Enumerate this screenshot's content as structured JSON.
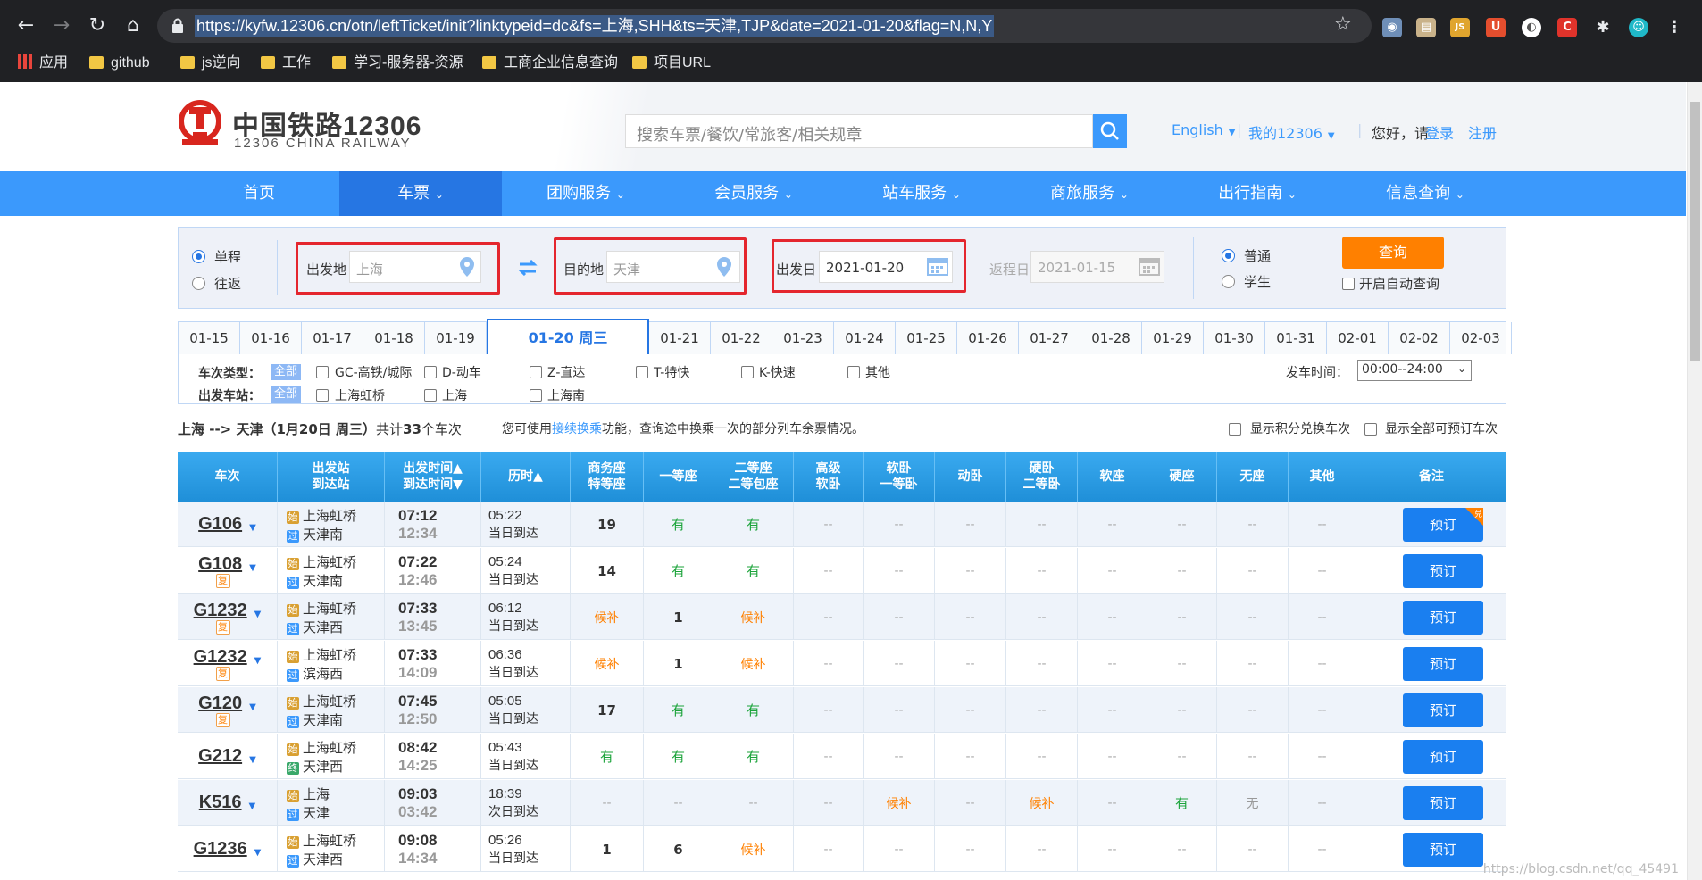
{
  "browser": {
    "url": "https://kyfw.12306.cn/otn/leftTicket/init?linktypeid=dc&fs=上海,SHH&ts=天津,TJP&date=2021-01-20&flag=N,N,Y",
    "bookmarks": [
      "应用",
      "github",
      "js逆向",
      "工作",
      "学习-服务器-资源",
      "工商企业信息查询",
      "项目URL"
    ],
    "ext_labels": {
      "u": "U",
      "c": "C",
      "js": "JS"
    }
  },
  "header": {
    "logo_cn": "中国铁路12306",
    "logo_en": "12306 CHINA RAILWAY",
    "search_placeholder": "搜索车票/餐饮/常旅客/相关规章",
    "english": "English",
    "my12306": "我的12306",
    "hello": "您好，请",
    "login": "登录",
    "register": "注册"
  },
  "nav": [
    "首页",
    "车票",
    "团购服务",
    "会员服务",
    "站车服务",
    "商旅服务",
    "出行指南",
    "信息查询"
  ],
  "query": {
    "oneway": "单程",
    "roundtrip": "往返",
    "from_label": "出发地",
    "from_value": "上海",
    "to_label": "目的地",
    "to_value": "天津",
    "date_label": "出发日",
    "date_value": "2021-01-20",
    "return_label": "返程日",
    "return_value": "2021-01-15",
    "normal": "普通",
    "student": "学生",
    "search_btn": "查询",
    "auto_query": "开启自动查询"
  },
  "dates": [
    "01-15",
    "01-16",
    "01-17",
    "01-18",
    "01-19",
    "01-20 周三",
    "01-21",
    "01-22",
    "01-23",
    "01-24",
    "01-25",
    "01-26",
    "01-27",
    "01-28",
    "01-29",
    "01-30",
    "01-31",
    "02-01",
    "02-02",
    "02-03"
  ],
  "filters": {
    "type_label": "车次类型：",
    "station_label": "出发车站：",
    "all": "全部",
    "types": [
      "GC-高铁/城际",
      "D-动车",
      "Z-直达",
      "T-特快",
      "K-快速",
      "其他"
    ],
    "stations": [
      "上海虹桥",
      "上海",
      "上海南"
    ],
    "time_label": "发车时间：",
    "time_value": "00:00--24:00"
  },
  "summary": {
    "route": "上海 --> 天津（1月20日  周三）",
    "total_prefix": "共计",
    "count": "33",
    "total_suffix": "个车次",
    "tip_prefix": "您可使用",
    "tip_link": "接续换乘",
    "tip_suffix": "功能，查询途中换乘一次的部分列车余票情况。",
    "show_points": "显示积分兑换车次",
    "show_all": "显示全部可预订车次"
  },
  "columns": [
    [
      "车次",
      ""
    ],
    [
      "出发站",
      "到达站"
    ],
    [
      "出发时间▲",
      "到达时间▼"
    ],
    [
      "历时▲",
      ""
    ],
    [
      "商务座",
      "特等座"
    ],
    [
      "一等座",
      ""
    ],
    [
      "二等座",
      "二等包座"
    ],
    [
      "高级",
      "软卧"
    ],
    [
      "软卧",
      "一等卧"
    ],
    [
      "动卧",
      ""
    ],
    [
      "硬卧",
      "二等卧"
    ],
    [
      "软座",
      ""
    ],
    [
      "硬座",
      ""
    ],
    [
      "无座",
      ""
    ],
    [
      "其他",
      ""
    ],
    [
      "备注",
      ""
    ]
  ],
  "rows": [
    {
      "no": "G106",
      "fu": false,
      "from": "上海虹桥",
      "to": "天津南",
      "from_tag": "始",
      "to_tag": "过",
      "dep": "07:12",
      "arr": "12:34",
      "dur": "05:22",
      "day": "当日到达",
      "seats": [
        "19",
        "有",
        "有",
        "--",
        "--",
        "--",
        "--",
        "--",
        "--",
        "--",
        "--"
      ],
      "btn": "预订",
      "dui": true
    },
    {
      "no": "G108",
      "fu": true,
      "from": "上海虹桥",
      "to": "天津南",
      "from_tag": "始",
      "to_tag": "过",
      "dep": "07:22",
      "arr": "12:46",
      "dur": "05:24",
      "day": "当日到达",
      "seats": [
        "14",
        "有",
        "有",
        "--",
        "--",
        "--",
        "--",
        "--",
        "--",
        "--",
        "--"
      ],
      "btn": "预订",
      "dui": false
    },
    {
      "no": "G1232",
      "fu": true,
      "from": "上海虹桥",
      "to": "天津西",
      "from_tag": "始",
      "to_tag": "过",
      "dep": "07:33",
      "arr": "13:45",
      "dur": "06:12",
      "day": "当日到达",
      "seats": [
        "候补",
        "1",
        "候补",
        "--",
        "--",
        "--",
        "--",
        "--",
        "--",
        "--",
        "--"
      ],
      "btn": "预订",
      "dui": false
    },
    {
      "no": "G1232",
      "fu": true,
      "from": "上海虹桥",
      "to": "滨海西",
      "from_tag": "始",
      "to_tag": "过",
      "dep": "07:33",
      "arr": "14:09",
      "dur": "06:36",
      "day": "当日到达",
      "seats": [
        "候补",
        "1",
        "候补",
        "--",
        "--",
        "--",
        "--",
        "--",
        "--",
        "--",
        "--"
      ],
      "btn": "预订",
      "dui": false
    },
    {
      "no": "G120",
      "fu": true,
      "from": "上海虹桥",
      "to": "天津南",
      "from_tag": "始",
      "to_tag": "过",
      "dep": "07:45",
      "arr": "12:50",
      "dur": "05:05",
      "day": "当日到达",
      "seats": [
        "17",
        "有",
        "有",
        "--",
        "--",
        "--",
        "--",
        "--",
        "--",
        "--",
        "--"
      ],
      "btn": "预订",
      "dui": false
    },
    {
      "no": "G212",
      "fu": false,
      "from": "上海虹桥",
      "to": "天津西",
      "from_tag": "始",
      "to_tag": "终",
      "dep": "08:42",
      "arr": "14:25",
      "dur": "05:43",
      "day": "当日到达",
      "seats": [
        "有",
        "有",
        "有",
        "--",
        "--",
        "--",
        "--",
        "--",
        "--",
        "--",
        "--"
      ],
      "btn": "预订",
      "dui": false
    },
    {
      "no": "K516",
      "fu": false,
      "from": "上海",
      "to": "天津",
      "from_tag": "始",
      "to_tag": "过",
      "dep": "09:03",
      "arr": "03:42",
      "dur": "18:39",
      "day": "次日到达",
      "seats": [
        "--",
        "--",
        "--",
        "--",
        "候补",
        "--",
        "候补",
        "--",
        "有",
        "无",
        "--"
      ],
      "btn": "预订",
      "dui": false
    },
    {
      "no": "G1236",
      "fu": false,
      "from": "上海虹桥",
      "to": "天津西",
      "from_tag": "始",
      "to_tag": "过",
      "dep": "09:08",
      "arr": "14:34",
      "dur": "05:26",
      "day": "当日到达",
      "seats": [
        "1",
        "6",
        "候补",
        "--",
        "--",
        "--",
        "--",
        "--",
        "--",
        "--",
        "--"
      ],
      "btn": "预订",
      "dui": false
    }
  ],
  "fu_label": "复",
  "dui_label": "兑",
  "watermark": "https://blog.csdn.net/qq_45491"
}
